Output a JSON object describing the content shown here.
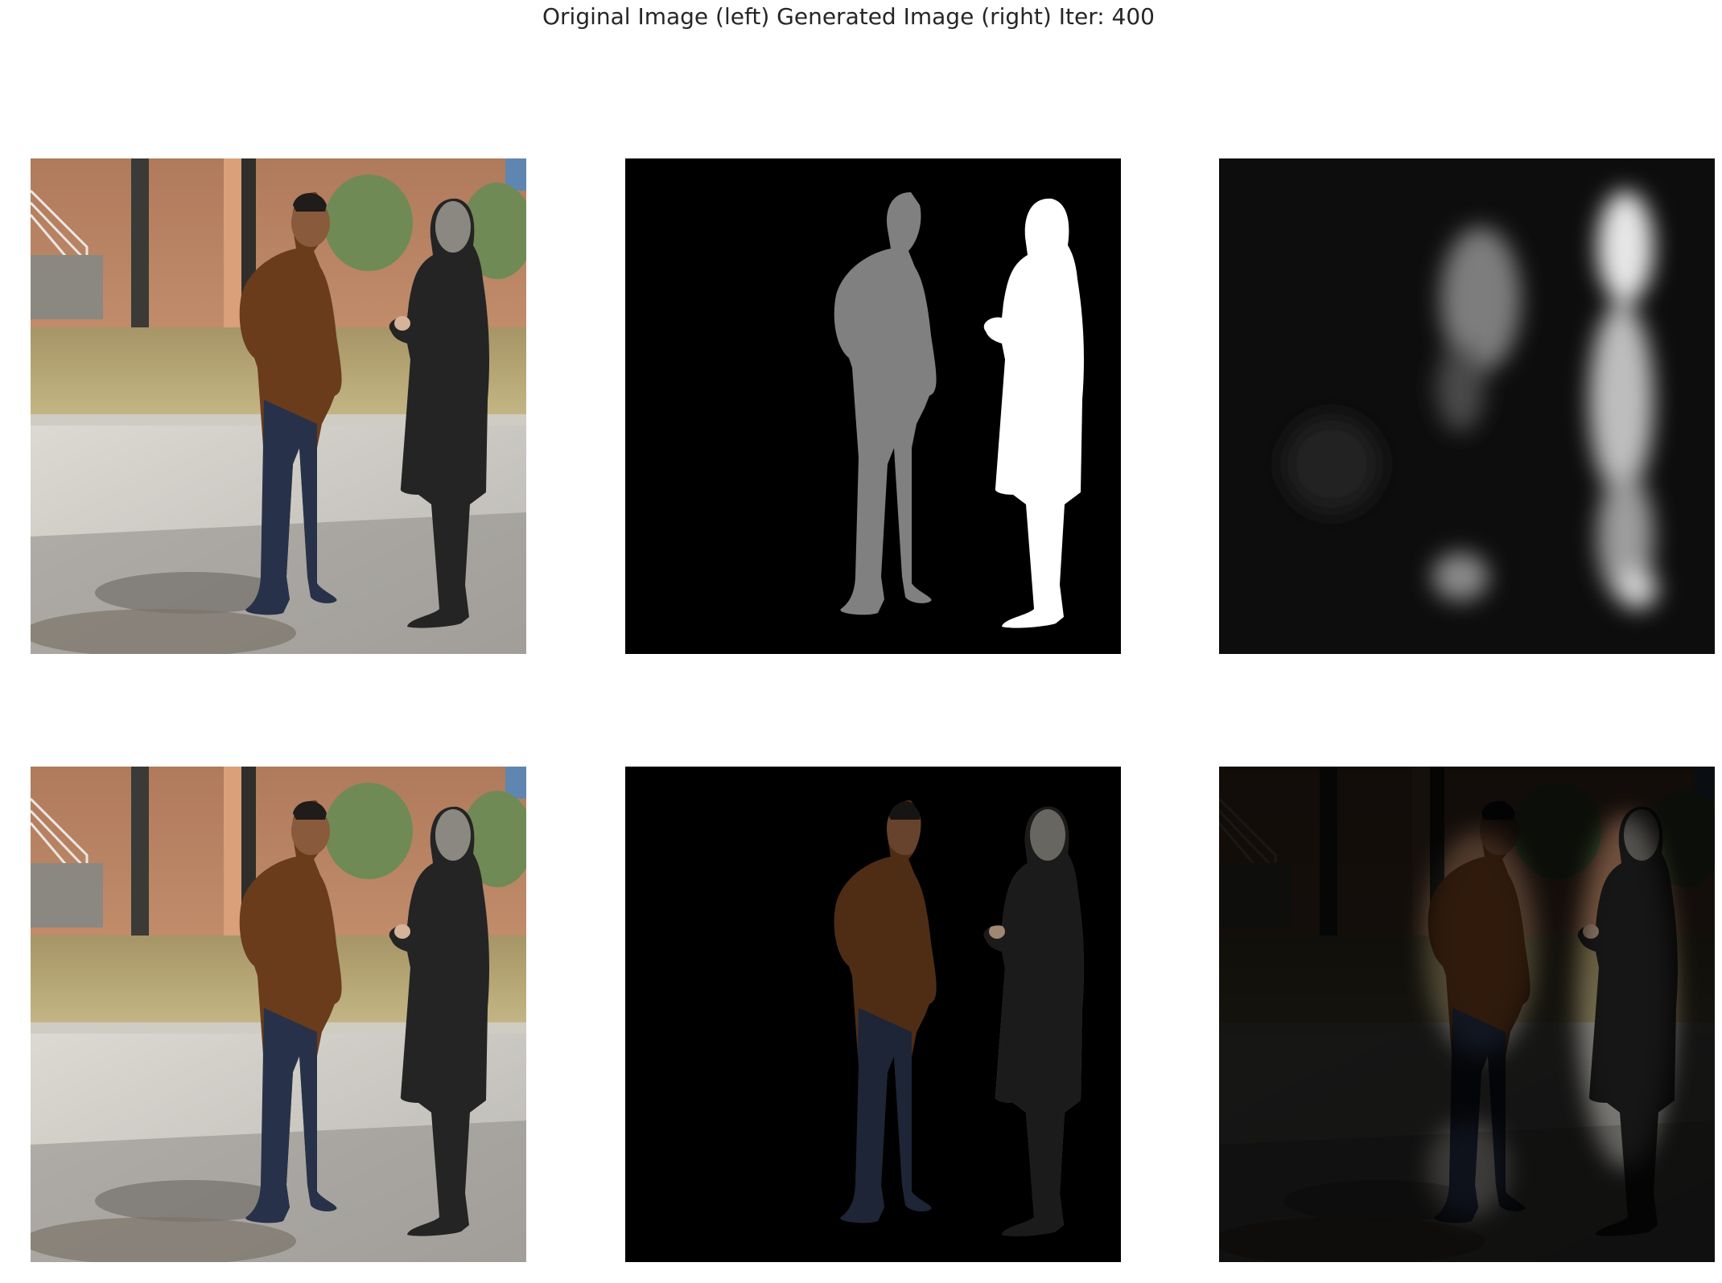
{
  "figure": {
    "title": "Original Image (left) Generated Image (right) Iter: 400"
  },
  "panels": [
    {
      "name": "original-photo-top",
      "kind": "photo"
    },
    {
      "name": "ground-truth-mask",
      "kind": "mask"
    },
    {
      "name": "generated-mask",
      "kind": "heatmap"
    },
    {
      "name": "original-photo-bottom",
      "kind": "photo"
    },
    {
      "name": "masked-ground-truth",
      "kind": "masked-photo"
    },
    {
      "name": "masked-generated",
      "kind": "dim-masked-photo"
    }
  ],
  "colors": {
    "background": "#ffffff",
    "title_text": "#262626",
    "mask_person_1": "#808080",
    "mask_person_2": "#ffffff"
  }
}
